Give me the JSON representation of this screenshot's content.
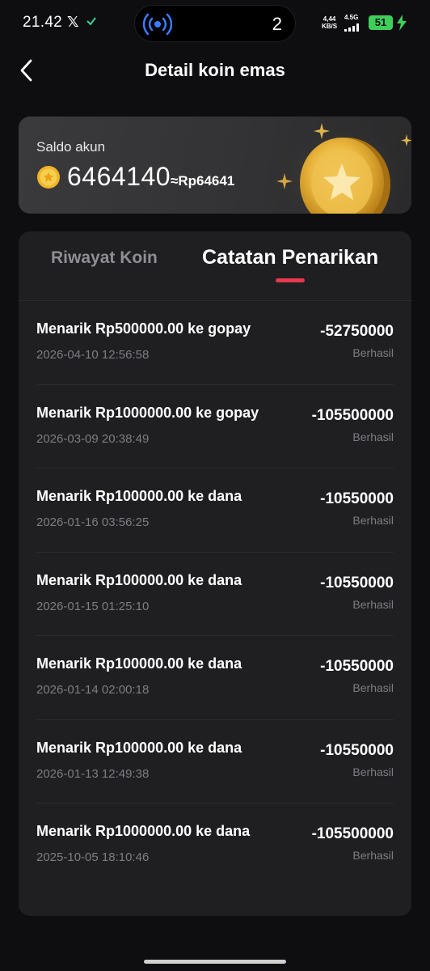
{
  "status_bar": {
    "time": "21.42",
    "x_app": "𝕏",
    "island_count": "2",
    "net_speed_value": "4,44",
    "net_speed_unit": "KB/S",
    "signal_label": "4.5G",
    "battery": "51"
  },
  "header": {
    "title": "Detail koin emas"
  },
  "balance": {
    "label": "Saldo akun",
    "amount": "6464140",
    "rupiah_equivalent": "≈Rp64641"
  },
  "tabs": {
    "coin_history": "Riwayat Koin",
    "withdrawal_records": "Catatan Penarikan",
    "active": "withdrawal_records"
  },
  "transactions": [
    {
      "title": "Menarik Rp500000.00 ke gopay",
      "date": "2026-04-10 12:56:58",
      "amount": "-52750000",
      "status": "Berhasil"
    },
    {
      "title": "Menarik Rp1000000.00 ke gopay",
      "date": "2026-03-09 20:38:49",
      "amount": "-105500000",
      "status": "Berhasil"
    },
    {
      "title": "Menarik Rp100000.00 ke dana",
      "date": "2026-01-16 03:56:25",
      "amount": "-10550000",
      "status": "Berhasil"
    },
    {
      "title": "Menarik Rp100000.00 ke dana",
      "date": "2026-01-15 01:25:10",
      "amount": "-10550000",
      "status": "Berhasil"
    },
    {
      "title": "Menarik Rp100000.00 ke dana",
      "date": "2026-01-14 02:00:18",
      "amount": "-10550000",
      "status": "Berhasil"
    },
    {
      "title": "Menarik Rp100000.00 ke dana",
      "date": "2026-01-13 12:49:38",
      "amount": "-10550000",
      "status": "Berhasil"
    },
    {
      "title": "Menarik Rp1000000.00 ke dana",
      "date": "2025-10-05 18:10:46",
      "amount": "-105500000",
      "status": "Berhasil"
    }
  ],
  "colors": {
    "background": "#0e0e10",
    "card": "#1f1f22",
    "tab_indicator": "#e8394d",
    "battery": "#3ecf5a",
    "coin_gold": "#f5c542",
    "muted_text": "#7d7d82"
  }
}
